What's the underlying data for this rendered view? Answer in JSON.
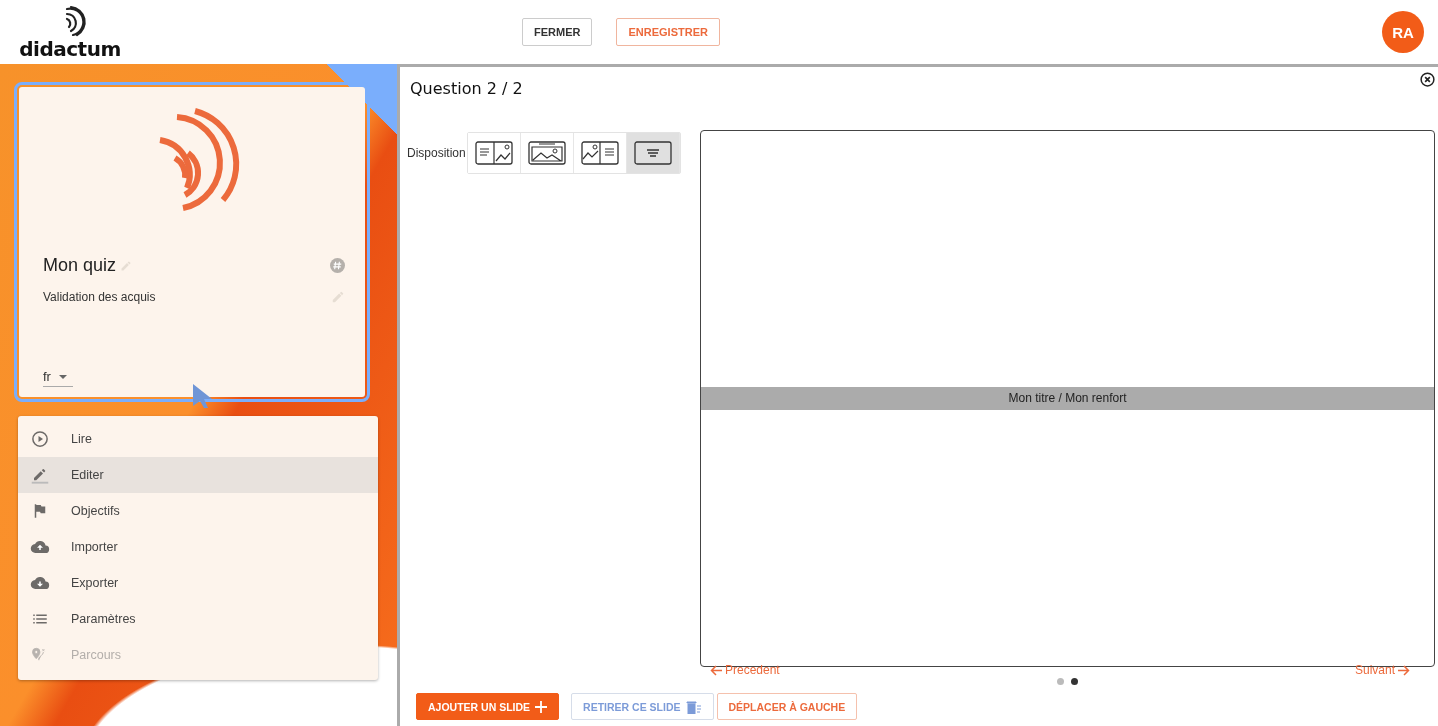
{
  "header": {
    "logo": "didactum",
    "buttons": [
      {
        "label": "FERMER",
        "kind": "neutral"
      },
      {
        "label": "ENREGISTRER",
        "kind": "primary"
      }
    ],
    "avatar": "RA"
  },
  "card": {
    "title": "Mon quiz",
    "description": "Validation des acquis",
    "language": "fr"
  },
  "menu": [
    {
      "label": "Lire",
      "kind": "play",
      "selected": false,
      "disabled": false
    },
    {
      "label": "Editer",
      "kind": "edit",
      "selected": true,
      "disabled": false
    },
    {
      "label": "Objectifs",
      "kind": "flag",
      "selected": false,
      "disabled": false
    },
    {
      "label": "Importer",
      "kind": "upload",
      "selected": false,
      "disabled": false
    },
    {
      "label": "Exporter",
      "kind": "download",
      "selected": false,
      "disabled": false
    },
    {
      "label": "Paramètres",
      "kind": "list",
      "selected": false,
      "disabled": false
    },
    {
      "label": "Parcours",
      "kind": "route",
      "selected": false,
      "disabled": true
    }
  ],
  "editor": {
    "title": "Question 2 / 2",
    "disposition_label": "Disposition",
    "layouts": [
      {
        "kind": "text-image",
        "selected": false
      },
      {
        "kind": "image",
        "selected": false
      },
      {
        "kind": "image-text",
        "selected": false
      },
      {
        "kind": "text",
        "selected": true
      }
    ],
    "slide_band": "Mon titre / Mon renfort",
    "previous": "Precedent",
    "next": "Suivant",
    "dots": [
      {
        "selected": false
      },
      {
        "selected": true
      }
    ],
    "actions": [
      {
        "label": "AJOUTER UN SLIDE",
        "kind": "add"
      },
      {
        "label": "RETIRER CE SLIDE",
        "kind": "remove"
      },
      {
        "label": "DÉPLACER À GAUCHE",
        "kind": "move"
      }
    ]
  }
}
